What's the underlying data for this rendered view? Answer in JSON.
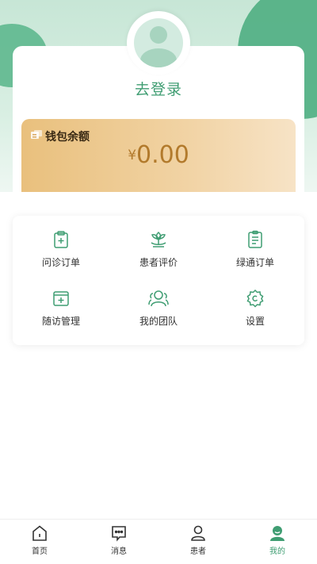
{
  "profile": {
    "login_label": "去登录"
  },
  "wallet": {
    "title": "钱包余额",
    "currency": "¥",
    "amount": "0.00"
  },
  "menu": {
    "items": [
      {
        "label": "问诊订单",
        "icon": "clipboard-plus-icon"
      },
      {
        "label": "患者评价",
        "icon": "flower-icon"
      },
      {
        "label": "绿通订单",
        "icon": "document-list-icon"
      },
      {
        "label": "随访管理",
        "icon": "medical-box-icon"
      },
      {
        "label": "我的团队",
        "icon": "team-icon"
      },
      {
        "label": "设置",
        "icon": "gear-icon"
      }
    ]
  },
  "tabbar": {
    "items": [
      {
        "label": "首页",
        "icon": "home-icon"
      },
      {
        "label": "消息",
        "icon": "message-icon"
      },
      {
        "label": "患者",
        "icon": "patient-icon"
      },
      {
        "label": "我的",
        "icon": "profile-icon"
      }
    ],
    "active_color": "#3f9d72"
  },
  "colors": {
    "accent": "#3f9d72",
    "wallet_amount": "#b27a2c"
  }
}
